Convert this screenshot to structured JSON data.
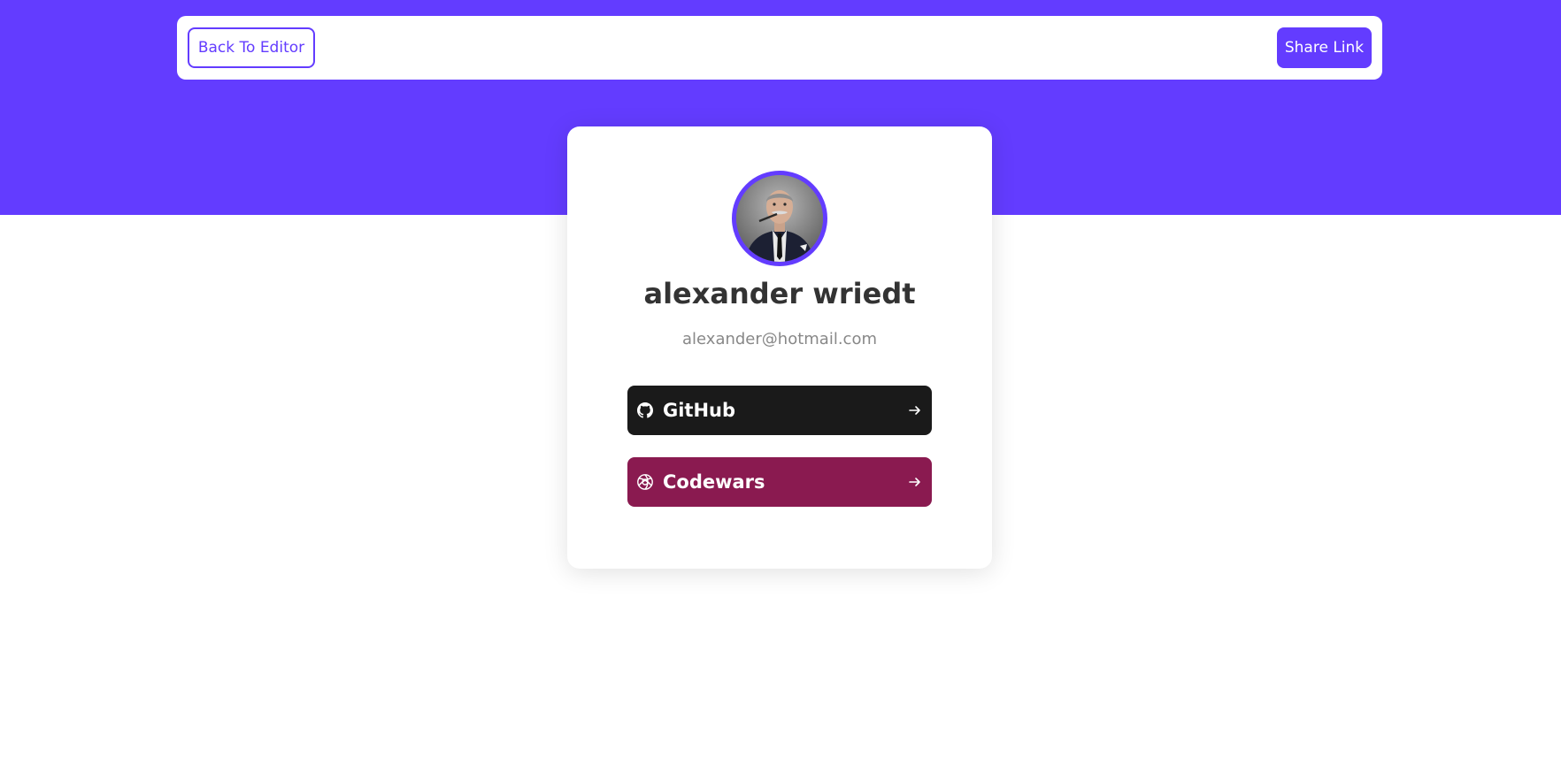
{
  "theme": {
    "accent": "#633cff",
    "text_dark": "#333333",
    "text_muted": "#888888"
  },
  "header": {
    "back_label": "Back To Editor",
    "share_label": "Share Link"
  },
  "profile": {
    "name": "alexander wriedt",
    "email": "alexander@hotmail.com",
    "avatar_icon": "profile-photo"
  },
  "links": [
    {
      "label": "GitHub",
      "icon": "github-icon",
      "color": "#1a1a1a",
      "arrow_icon": "arrow-right-icon"
    },
    {
      "label": "Codewars",
      "icon": "codewars-icon",
      "color": "#8a1a50",
      "arrow_icon": "arrow-right-icon"
    }
  ]
}
